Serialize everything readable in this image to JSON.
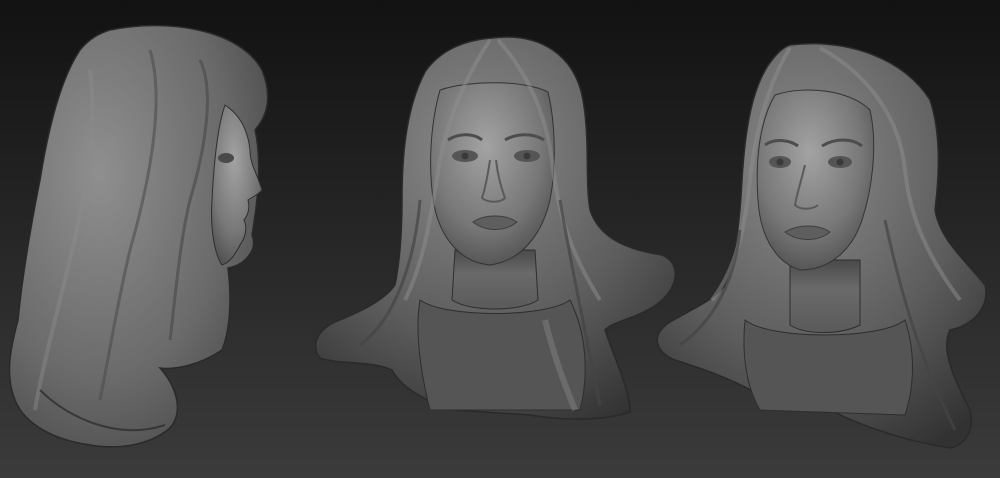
{
  "scene": {
    "subject": "sculpted-female-head-bust",
    "material": "matcap-gray-clay",
    "background_top": "#141414",
    "background_bottom": "#3a3a3a",
    "clay_light": "#9a9a9a",
    "clay_mid": "#6b6b6b",
    "clay_dark": "#3b3b3b",
    "views": [
      {
        "id": "side",
        "orientation": "right-profile"
      },
      {
        "id": "front",
        "orientation": "front"
      },
      {
        "id": "three-quarter",
        "orientation": "three-quarter-left"
      }
    ]
  }
}
